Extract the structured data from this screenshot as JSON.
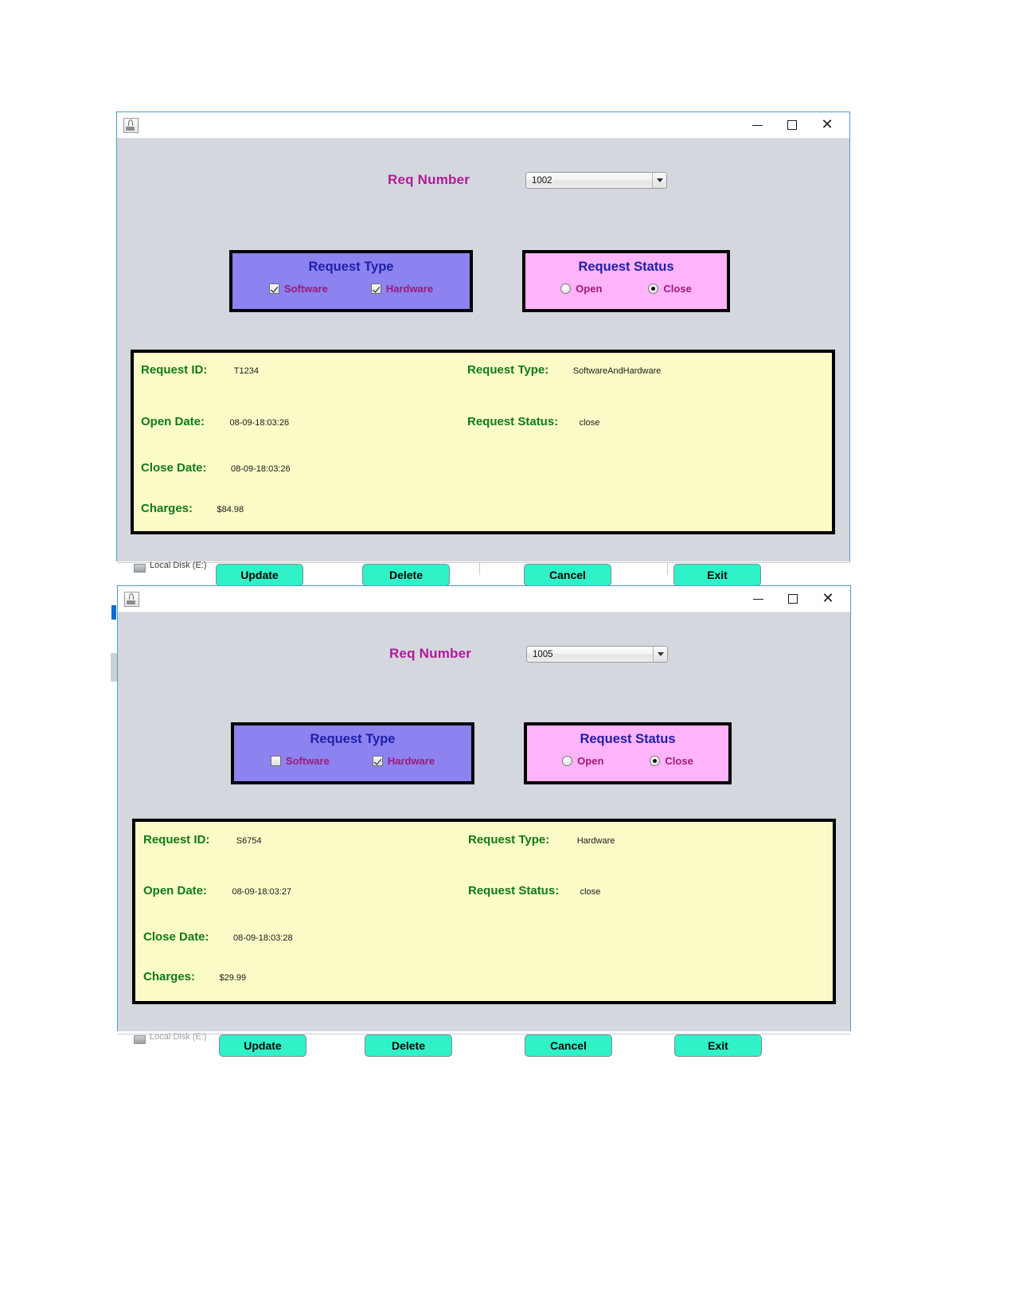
{
  "windows": [
    {
      "id": "window-1002",
      "titlebar": {
        "app_icon": "java-coffee-cup-icon",
        "minimize_label": "–",
        "maximize_label": "□",
        "close_label": "✕"
      },
      "req_number": {
        "label": "Req Number",
        "selected_value": "1002",
        "dropdown_icon": "chevron-down-icon"
      },
      "request_type": {
        "title": "Request Type",
        "options": [
          {
            "label": "Software",
            "checked": true
          },
          {
            "label": "Hardware",
            "checked": true
          }
        ]
      },
      "request_status": {
        "title": "Request Status",
        "options": [
          {
            "label": "Open",
            "selected": false
          },
          {
            "label": "Close",
            "selected": true
          }
        ]
      },
      "details": {
        "request_id_label": "Request ID:",
        "request_id_value": "T1234",
        "open_date_label": "Open Date:",
        "open_date_value": "08-09-18:03:26",
        "close_date_label": "Close Date:",
        "close_date_value": "08-09-18:03:26",
        "charges_label": "Charges:",
        "charges_value": "$84.98",
        "request_type_label": "Request Type:",
        "request_type_value": "SoftwareAndHardware",
        "request_status_label": "Request Status:",
        "request_status_value": "close"
      },
      "actions": {
        "update": "Update",
        "delete": "Delete",
        "cancel": "Cancel",
        "exit": "Exit"
      },
      "background_bleed": {
        "drive_label": "Local Disk (E:)"
      }
    },
    {
      "id": "window-1005",
      "titlebar": {
        "app_icon": "java-coffee-cup-icon",
        "minimize_label": "–",
        "maximize_label": "□",
        "close_label": "✕"
      },
      "req_number": {
        "label": "Req Number",
        "selected_value": "1005",
        "dropdown_icon": "chevron-down-icon"
      },
      "request_type": {
        "title": "Request Type",
        "options": [
          {
            "label": "Software",
            "checked": false
          },
          {
            "label": "Hardware",
            "checked": true
          }
        ]
      },
      "request_status": {
        "title": "Request Status",
        "options": [
          {
            "label": "Open",
            "selected": false
          },
          {
            "label": "Close",
            "selected": true
          }
        ]
      },
      "details": {
        "request_id_label": "Request ID:",
        "request_id_value": "S6754",
        "open_date_label": "Open Date:",
        "open_date_value": "08-09-18:03:27",
        "close_date_label": "Close Date:",
        "close_date_value": "08-09-18:03:28",
        "charges_label": "Charges:",
        "charges_value": "$29.99",
        "request_type_label": "Request Type:",
        "request_type_value": "Hardware",
        "request_status_label": "Request Status:",
        "request_status_value": "close"
      },
      "actions": {
        "update": "Update",
        "delete": "Delete",
        "cancel": "Cancel",
        "exit": "Exit"
      },
      "background_bleed": {
        "drive_label": "Local Disk (E:)"
      }
    }
  ],
  "colors": {
    "window_bg": "#d4d7dd",
    "type_panel": "#8c82f0",
    "status_panel": "#ffb3f9",
    "details_panel": "#fbfbc8",
    "button": "#2ff2c8",
    "req_label": "#b3189b",
    "panel_title": "#1e1ea8",
    "option_label": "#9d1a7a",
    "detail_key": "#117a17",
    "window_border": "#4a9ec9"
  }
}
